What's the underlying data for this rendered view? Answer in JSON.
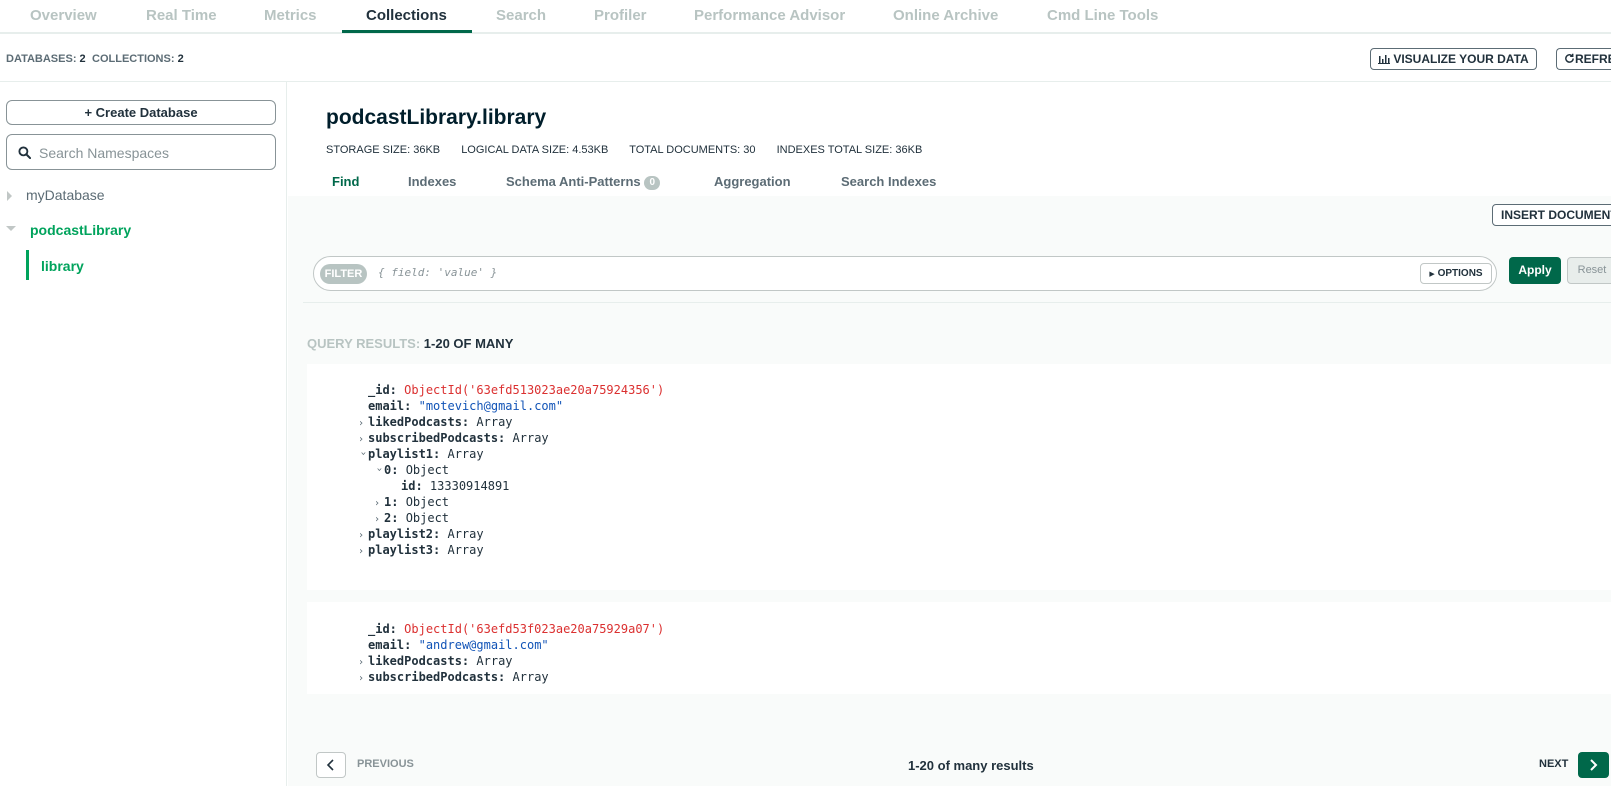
{
  "topnav": {
    "tabs": [
      "Overview",
      "Real Time",
      "Metrics",
      "Collections",
      "Search",
      "Profiler",
      "Performance Advisor",
      "Online Archive",
      "Cmd Line Tools"
    ],
    "active": "Collections"
  },
  "stats": {
    "databases_label": "DATABASES:",
    "databases_value": "2",
    "collections_label": "COLLECTIONS:",
    "collections_value": "2",
    "visualize_label": "VISUALIZE YOUR DATA",
    "refresh_label": "REFRE"
  },
  "sidebar": {
    "create_db_label": "Create Database",
    "search_placeholder": "Search Namespaces",
    "databases": [
      {
        "name": "myDatabase",
        "expanded": false
      },
      {
        "name": "podcastLibrary",
        "expanded": true
      }
    ],
    "active_collection": "library"
  },
  "collection": {
    "title": "podcastLibrary.library",
    "storage_size": "STORAGE SIZE: 36KB",
    "logical_size": "LOGICAL DATA SIZE: 4.53KB",
    "total_docs": "TOTAL DOCUMENTS: 30",
    "indexes_size": "INDEXES TOTAL SIZE: 36KB",
    "subtabs": [
      "Find",
      "Indexes",
      "Schema Anti-Patterns",
      "Aggregation",
      "Search Indexes"
    ],
    "antipattern_count": "0",
    "active_subtab": "Find"
  },
  "query": {
    "insert_label": "INSERT DOCUMENT",
    "filter_label": "FILTER",
    "filter_placeholder": "{ field: 'value' }",
    "options_label": "OPTIONS",
    "apply_label": "Apply",
    "reset_label": "Reset",
    "results_label": "QUERY RESULTS:",
    "results_range": "1-20 OF MANY"
  },
  "documents": [
    {
      "id_key": "_id:",
      "id_value": "ObjectId('63efd513023ae20a75924356')",
      "email_key": "email:",
      "email_value": "\"motevich@gmail.com\"",
      "liked": "likedPodcasts:",
      "liked_type": "Array",
      "subscribed": "subscribedPodcasts:",
      "subscribed_type": "Array",
      "playlist1": "playlist1:",
      "playlist1_type": "Array",
      "item0": "0:",
      "item0_type": "Object",
      "item0_id_key": "id:",
      "item0_id_value": "13330914891",
      "item1": "1:",
      "item1_type": "Object",
      "item2": "2:",
      "item2_type": "Object",
      "playlist2": "playlist2:",
      "playlist2_type": "Array",
      "playlist3": "playlist3:",
      "playlist3_type": "Array"
    },
    {
      "id_key": "_id:",
      "id_value": "ObjectId('63efd53f023ae20a75929a07')",
      "email_key": "email:",
      "email_value": "\"andrew@gmail.com\"",
      "liked": "likedPodcasts:",
      "liked_type": "Array",
      "subscribed": "subscribedPodcasts:",
      "subscribed_type": "Array"
    }
  ],
  "pager": {
    "previous_label": "PREVIOUS",
    "count_label": "1-20 of many results",
    "next_label": "NEXT"
  },
  "colors": {
    "accent": "#00684a",
    "objectid": "#db3030",
    "string": "#1254b7"
  }
}
